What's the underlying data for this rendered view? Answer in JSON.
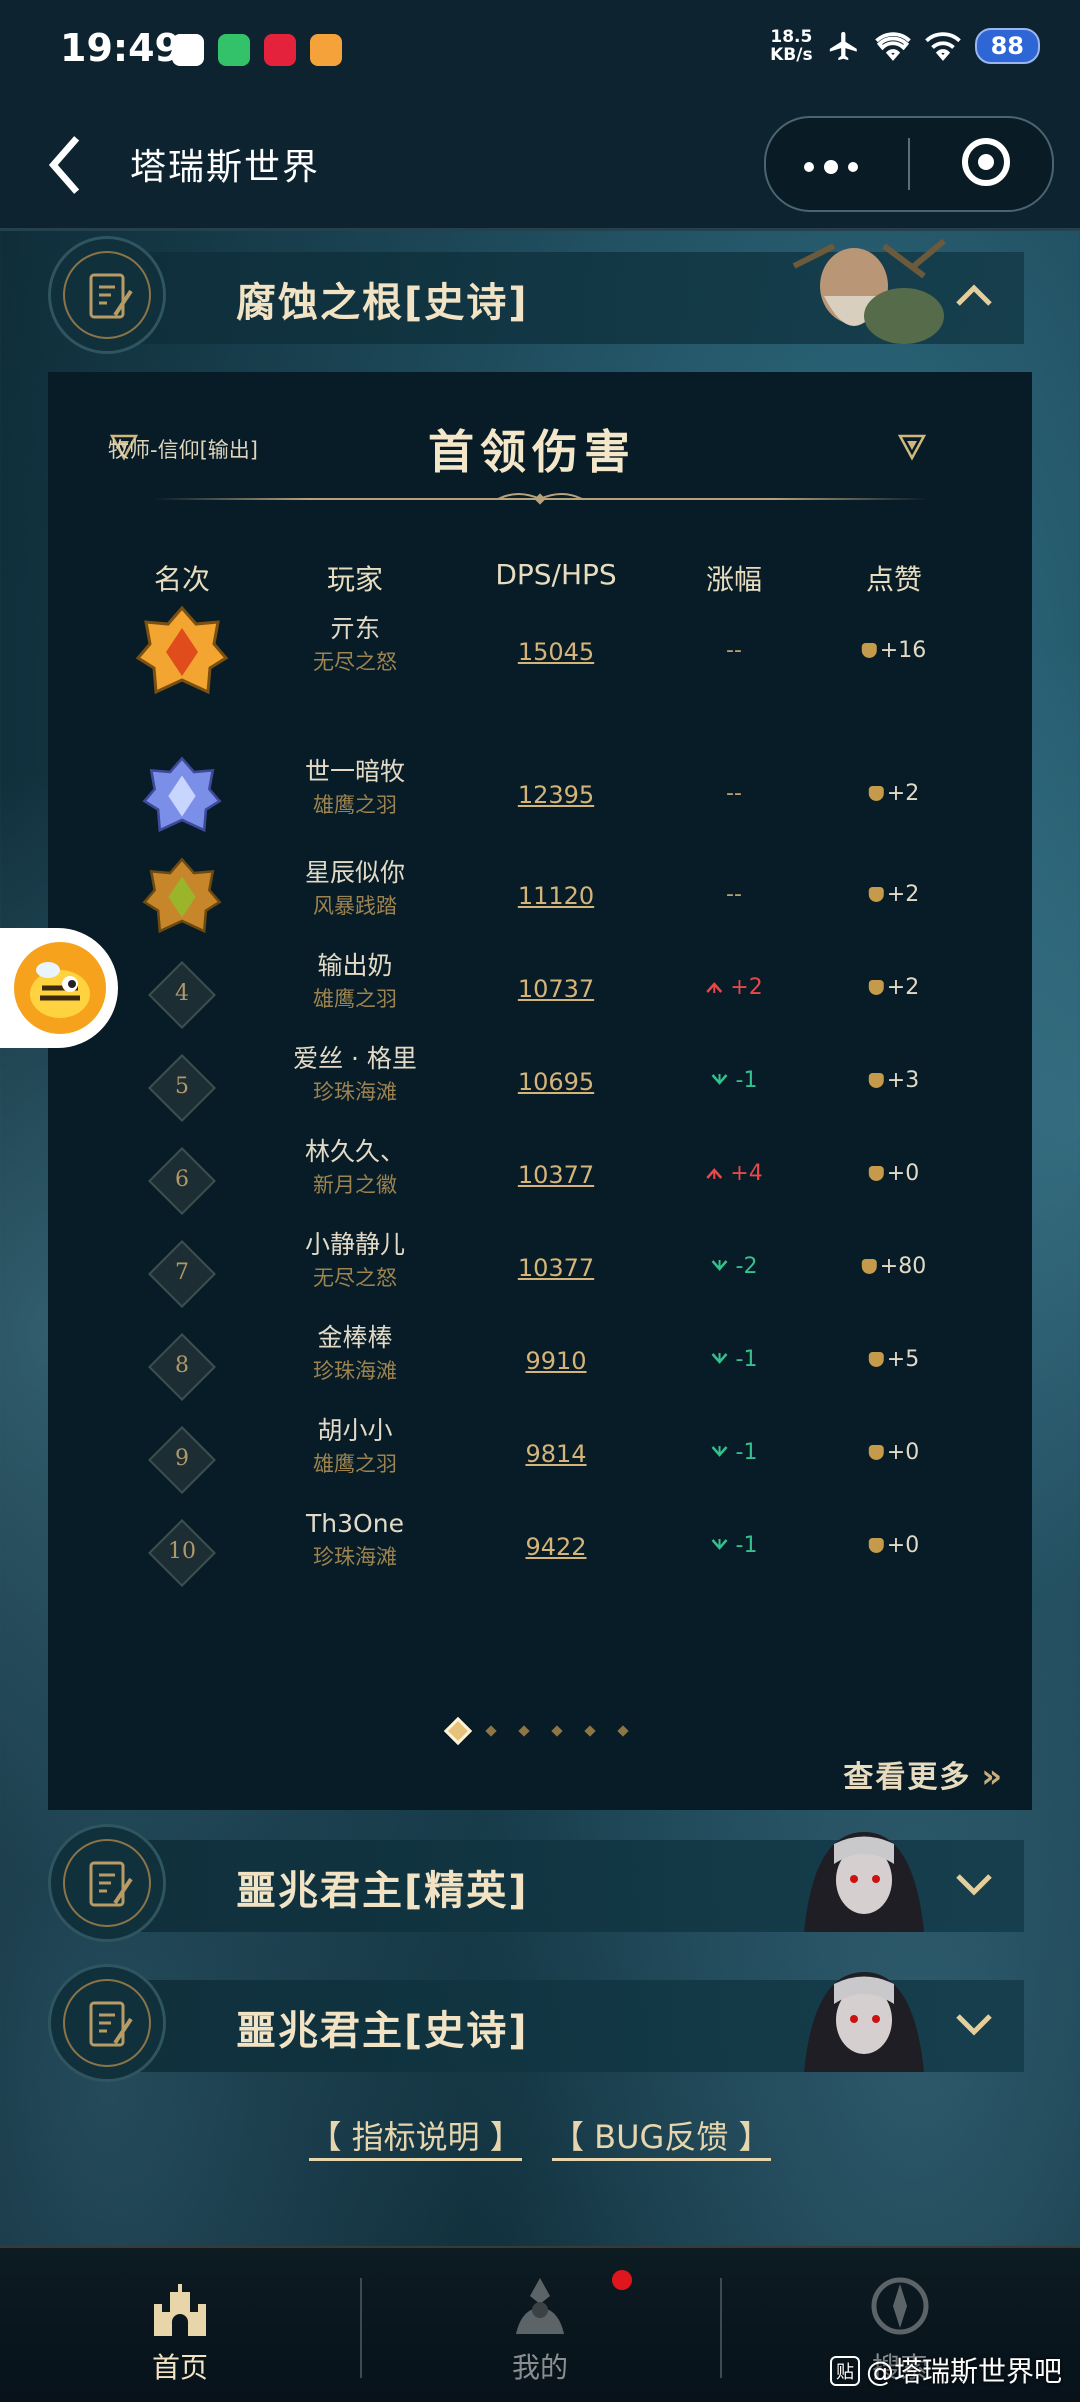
{
  "status_bar": {
    "time": "19:49",
    "net_speed": "18.5",
    "net_unit": "KB/s",
    "battery": "88"
  },
  "nav": {
    "title": "塔瑞斯世界"
  },
  "sections": [
    {
      "name": "腐蚀之根[史诗]",
      "expanded": true
    },
    {
      "name": "噩兆君主[精英]",
      "expanded": false
    },
    {
      "name": "噩兆君主[史诗]",
      "expanded": false
    }
  ],
  "panel": {
    "class_label": "牧师-信仰[输出]",
    "title": "首领伤害",
    "columns": [
      "名次",
      "玩家",
      "DPS/HPS",
      "涨幅",
      "点赞"
    ],
    "rows": [
      {
        "rank": "1",
        "player": "亓东",
        "guild": "无尽之怒",
        "dps": "15045",
        "change": "--",
        "change_dir": "same",
        "likes": "+16"
      },
      {
        "rank": "2",
        "player": "世一暗牧",
        "guild": "雄鹰之羽",
        "dps": "12395",
        "change": "--",
        "change_dir": "same",
        "likes": "+2"
      },
      {
        "rank": "3",
        "player": "星辰似你",
        "guild": "风暴践踏",
        "dps": "11120",
        "change": "--",
        "change_dir": "same",
        "likes": "+2"
      },
      {
        "rank": "4",
        "player": "输出奶",
        "guild": "雄鹰之羽",
        "dps": "10737",
        "change": "+2",
        "change_dir": "up",
        "likes": "+2"
      },
      {
        "rank": "5",
        "player": "爱丝 · 格里",
        "guild": "珍珠海滩",
        "dps": "10695",
        "change": "-1",
        "change_dir": "down",
        "likes": "+3"
      },
      {
        "rank": "6",
        "player": "林久久、",
        "guild": "新月之徽",
        "dps": "10377",
        "change": "+4",
        "change_dir": "up",
        "likes": "+0"
      },
      {
        "rank": "7",
        "player": "小静静儿",
        "guild": "无尽之怒",
        "dps": "10377",
        "change": "-2",
        "change_dir": "down",
        "likes": "+80"
      },
      {
        "rank": "8",
        "player": "金棒棒",
        "guild": "珍珠海滩",
        "dps": "9910",
        "change": "-1",
        "change_dir": "down",
        "likes": "+5"
      },
      {
        "rank": "9",
        "player": "胡小小",
        "guild": "雄鹰之羽",
        "dps": "9814",
        "change": "-1",
        "change_dir": "down",
        "likes": "+0"
      },
      {
        "rank": "10",
        "player": "Th3One",
        "guild": "珍珠海滩",
        "dps": "9422",
        "change": "-1",
        "change_dir": "down",
        "likes": "+0"
      }
    ],
    "pager": {
      "pages": 6,
      "current": 1
    },
    "more": "查看更多"
  },
  "links": {
    "metrics": "【 指标说明 】",
    "bug": "【 BUG反馈 】"
  },
  "tabs": [
    {
      "label": "首页",
      "active": true
    },
    {
      "label": "我的",
      "active": false
    },
    {
      "label": "搜索",
      "active": false
    }
  ],
  "watermark": {
    "badge": "贴",
    "text": "@塔瑞斯世界吧"
  },
  "colors": {
    "accent_gold": "#d5b47a",
    "up": "#e84848",
    "down": "#35c08d",
    "panel_bg": "#071c26"
  }
}
